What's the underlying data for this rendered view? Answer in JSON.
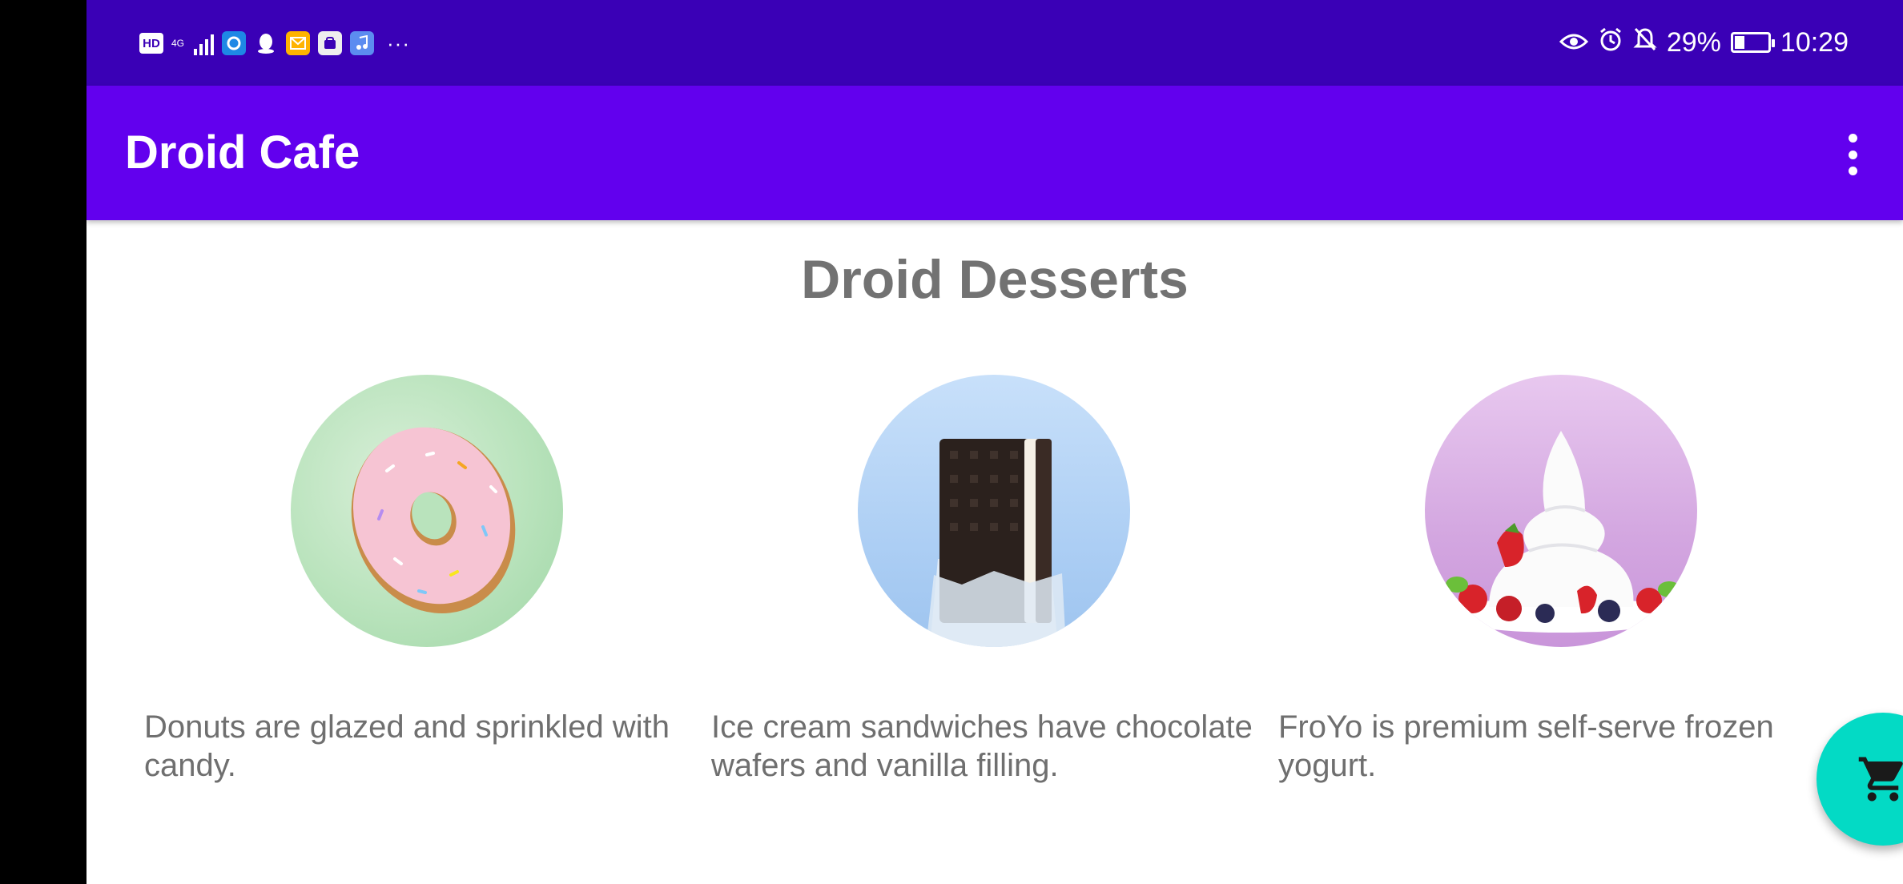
{
  "status_bar": {
    "left_icons": [
      "hd-icon",
      "signal-4g-icon",
      "browser-app-icon",
      "qq-app-icon",
      "email-app-icon",
      "huawei-app-icon",
      "music-app-icon"
    ],
    "network_label": "4G",
    "hd_label": "HD",
    "more": "···",
    "battery_percent": "29%",
    "time": "10:29",
    "battery_level": 0.29
  },
  "app_bar": {
    "title": "Droid Cafe"
  },
  "main": {
    "heading": "Droid Desserts",
    "desserts": [
      {
        "name": "donut",
        "description_line1": "Donuts are glazed and sprinkled with",
        "description_line2": "candy."
      },
      {
        "name": "ice-cream-sandwich",
        "description_line1": "Ice cream sandwiches have chocolate",
        "description_line2": "wafers and vanilla filling."
      },
      {
        "name": "froyo",
        "description_line1": "FroYo is premium self-serve frozen",
        "description_line2": "yogurt."
      }
    ]
  },
  "fab": {
    "icon": "shopping-cart-icon",
    "color": "#03DAC5"
  },
  "colors": {
    "status_bar": "#3A00B6",
    "app_bar": "#6200EE",
    "heading_text": "#727272"
  }
}
